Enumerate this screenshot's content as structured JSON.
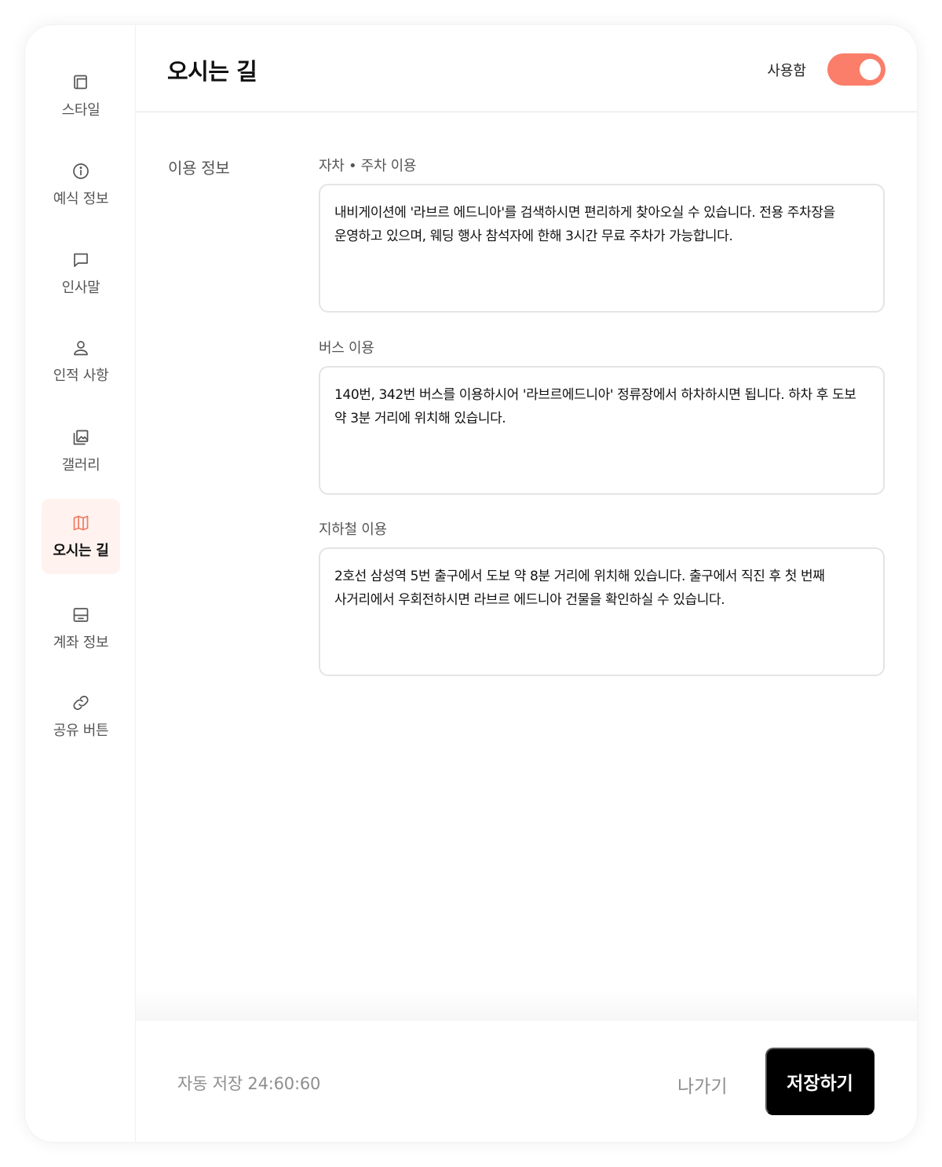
{
  "sidebar": {
    "items": [
      {
        "label": "스타일",
        "icon": "style-icon"
      },
      {
        "label": "예식 정보",
        "icon": "info-icon"
      },
      {
        "label": "인사말",
        "icon": "message-icon"
      },
      {
        "label": "인적 사항",
        "icon": "person-icon"
      },
      {
        "label": "갤러리",
        "icon": "gallery-icon"
      },
      {
        "label": "오시는 길",
        "icon": "map-icon",
        "active": true
      },
      {
        "label": "계좌 정보",
        "icon": "account-icon"
      },
      {
        "label": "공유 버튼",
        "icon": "link-icon"
      }
    ]
  },
  "header": {
    "title": "오시는 길",
    "toggle_label": "사용함",
    "toggle_on": true
  },
  "main": {
    "section_label": "이용 정보",
    "fields": [
      {
        "label": "자차 • 주차 이용",
        "value": "내비게이션에 '라브르 에드니아'를 검색하시면 편리하게 찾아오실 수 있습니다. 전용 주차장을 운영하고 있으며, 웨딩 행사 참석자에 한해 3시간 무료 주차가 가능합니다."
      },
      {
        "label": "버스 이용",
        "value": "140번, 342번 버스를 이용하시어 '라브르에드니아' 정류장에서 하차하시면 됩니다. 하차 후 도보 약 3분 거리에 위치해 있습니다."
      },
      {
        "label": "지하철 이용",
        "value": "2호선 삼성역 5번 출구에서 도보 약 8분 거리에 위치해 있습니다. 출구에서 직진 후 첫 번째 사거리에서 우회전하시면 라브르 에드니아 건물을 확인하실 수 있습니다."
      }
    ]
  },
  "footer": {
    "autosave": "자동 저장 24:60:60",
    "exit_label": "나가기",
    "save_label": "저장하기"
  },
  "colors": {
    "accent": "#fa7e6a",
    "active_bg": "#fff2ef",
    "save_bg": "#000000"
  }
}
